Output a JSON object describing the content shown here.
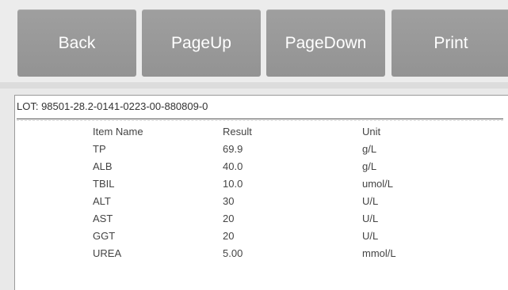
{
  "toolbar": {
    "back_label": "Back",
    "pageup_label": "PageUp",
    "pagedown_label": "PageDown",
    "print_label": "Print"
  },
  "report": {
    "lot": "LOT: 98501-28.2-0141-0223-00-880809-0",
    "headers": {
      "item": "Item Name",
      "result": "Result",
      "unit": "Unit"
    },
    "rows": [
      {
        "item": "TP",
        "result": "69.9",
        "unit": "g/L"
      },
      {
        "item": "ALB",
        "result": "40.0",
        "unit": "g/L"
      },
      {
        "item": "TBIL",
        "result": "10.0",
        "unit": "umol/L"
      },
      {
        "item": "ALT",
        "result": "30",
        "unit": "U/L"
      },
      {
        "item": "AST",
        "result": "20",
        "unit": "U/L"
      },
      {
        "item": "GGT",
        "result": "20",
        "unit": "U/L"
      },
      {
        "item": "UREA",
        "result": "5.00",
        "unit": "mmol/L"
      }
    ]
  }
}
